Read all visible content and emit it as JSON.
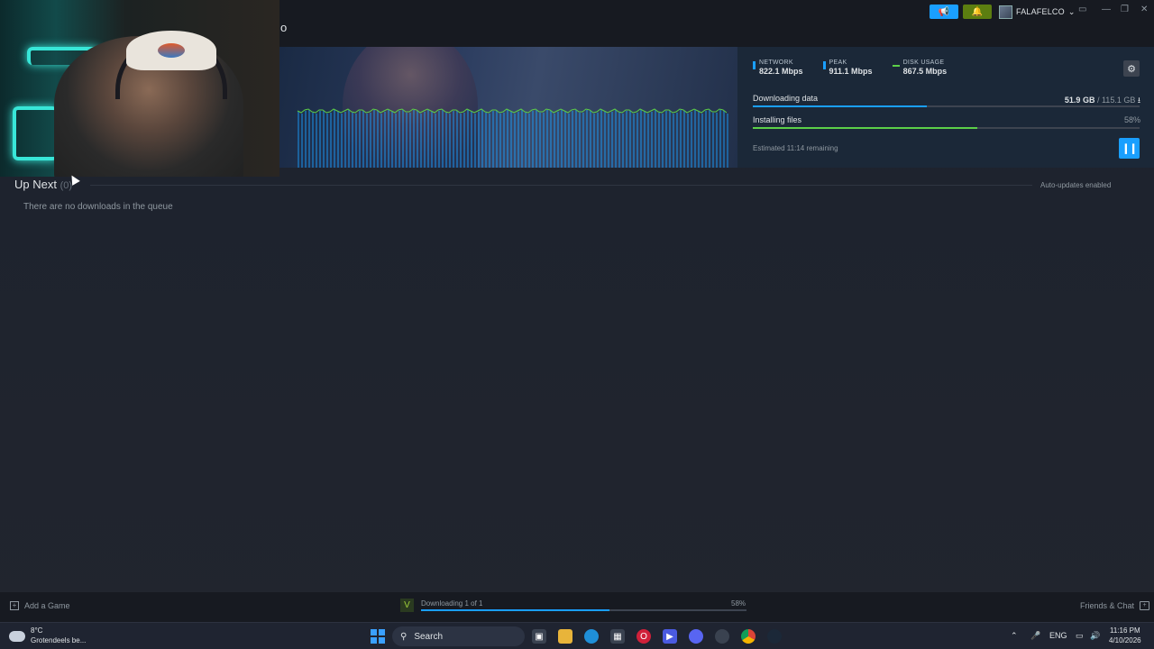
{
  "titlebar": {
    "title_fragment": "o",
    "user_name": "FALAFELCO",
    "announce_icon": "megaphone-icon",
    "notify_icon": "bell-icon",
    "colors": {
      "announce": "#1a9fff",
      "notify": "#5c7e10"
    }
  },
  "download": {
    "network_label": "NETWORK",
    "network_value": "822.1 Mbps",
    "peak_label": "PEAK",
    "peak_value": "911.1 Mbps",
    "disk_label": "DISK USAGE",
    "disk_value": "867.5 Mbps",
    "downloading_label": "Downloading data",
    "downloaded": "51.9 GB",
    "total_size": "/ 115.1 GB",
    "download_progress": 0.45,
    "installing_label": "Installing files",
    "installing_percent": "58%",
    "install_progress": 0.58,
    "estimate": "Estimated 11:14 remaining",
    "colors": {
      "network": "#1a9fff",
      "peak": "#1a9fff",
      "disk": "#5cd048",
      "download_bar": "#1a9fff",
      "install_bar": "#5cd048"
    }
  },
  "queue": {
    "title": "Up Next",
    "count": "(0)",
    "auto_updates": "Auto-updates enabled",
    "empty_message": "There are no downloads in the queue"
  },
  "footer": {
    "add_game": "Add a Game",
    "status": "Downloading 1 of 1",
    "percent": "58%",
    "progress": 0.58,
    "friends": "Friends & Chat"
  },
  "taskbar": {
    "temp": "8°C",
    "weather": "Grotendeels be...",
    "search": "Search",
    "lang": "ENG",
    "time": "11:16 PM",
    "date": "4/10/2026"
  }
}
